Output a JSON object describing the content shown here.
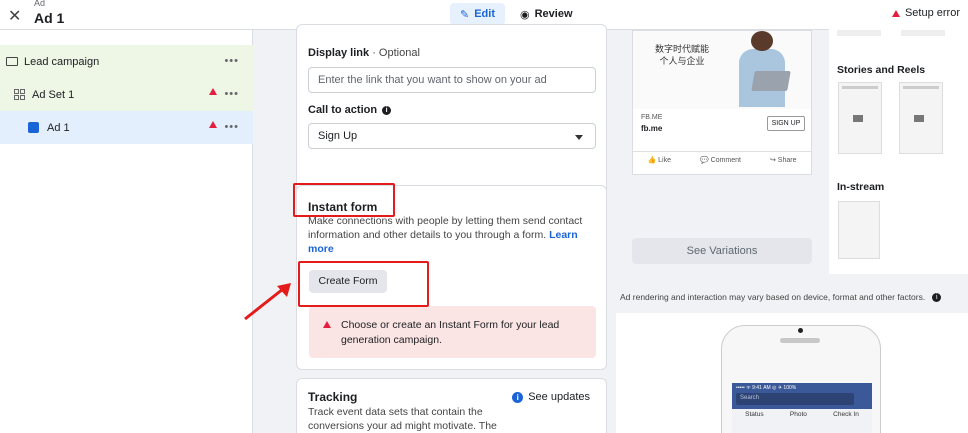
{
  "header": {
    "breadcrumb_small": "Ad",
    "title": "Ad 1",
    "edit_label": "Edit",
    "review_label": "Review",
    "setup_error": "Setup error"
  },
  "sidebar": {
    "items": [
      {
        "label": "Lead campaign",
        "level": "campaign",
        "warning": false
      },
      {
        "label": "Ad Set 1",
        "level": "adset",
        "warning": true
      },
      {
        "label": "Ad 1",
        "level": "ad",
        "warning": true
      }
    ],
    "more_label": "•••"
  },
  "editor": {
    "display_link": {
      "label": "Display link",
      "optional": "· Optional",
      "placeholder": "Enter the link that you want to show on your ad"
    },
    "call_to_action": {
      "label": "Call to action",
      "value": "Sign Up"
    },
    "instant_form": {
      "title": "Instant form",
      "description": "Make connections with people by letting them send contact information and other details to you through a form.",
      "learn_more": "Learn more",
      "create_button": "Create Form",
      "alert": "Choose or create an Instant Form for your lead generation campaign."
    },
    "tracking": {
      "title": "Tracking",
      "see_updates": "See updates",
      "description": "Track event data sets that contain the conversions your ad might motivate. The"
    }
  },
  "preview": {
    "ad_text": [
      "数字时代赋能",
      "个人与企业"
    ],
    "url_small": "FB.ME",
    "url_domain": "fb.me",
    "cta": "SIGN UP",
    "actions": [
      "Like",
      "Comment",
      "Share"
    ],
    "see_variations": "See Variations",
    "stories_title": "Stories and Reels",
    "instream_title": "In-stream",
    "footnote": "Ad rendering and interaction may vary based on device, format and other factors.",
    "phone": {
      "status": "••••• ᯤ   9:41 AM   ◎ ✈ 100%",
      "search": "Search",
      "tabs": [
        "Status",
        "Photo",
        "Check In"
      ]
    }
  },
  "colors": {
    "accent_blue": "#1b64d8",
    "error_red": "#e41e3f",
    "annotation_red": "#e51b1b",
    "campaign_bg": "#eef6e6",
    "selected_bg": "#e3effd"
  }
}
